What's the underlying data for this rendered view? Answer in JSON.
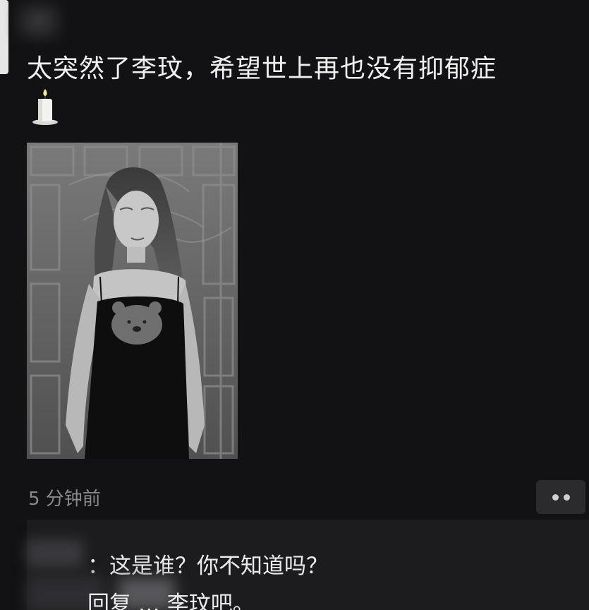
{
  "post": {
    "text": "太突然了李玟，希望世上再也没有抑郁症",
    "emoji": "candle-icon"
  },
  "photo": {
    "description_icon": "bear-sticker-icon"
  },
  "meta": {
    "time": "5 分钟前"
  },
  "actions": {
    "more_icon": "more-dots-icon"
  },
  "comments": [
    {
      "text": "：这是谁？你不知道吗？"
    },
    {
      "text": "回复 … 李玟吧。"
    }
  ],
  "colors": {
    "background": "#121214",
    "text": "#f0f0f0",
    "muted": "#8a8a8e",
    "comment_bg": "#1c1c1f"
  }
}
